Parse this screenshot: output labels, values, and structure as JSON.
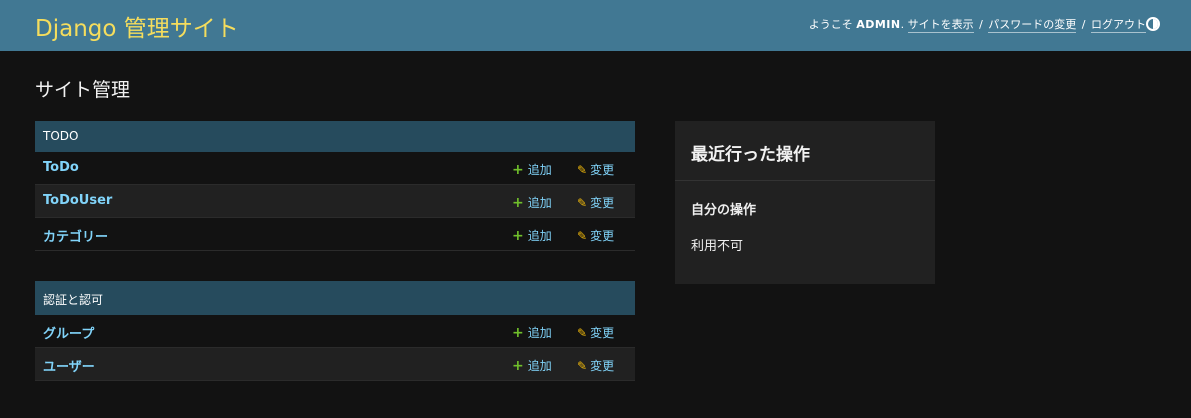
{
  "header": {
    "branding": "Django 管理サイト",
    "welcome": "ようこそ ",
    "username": "ADMIN",
    "welcome_suffix": ". ",
    "view_site": "サイトを表示",
    "separator": " / ",
    "change_password": "パスワードの変更",
    "logout": "ログアウト",
    "theme_icon": "half-circle-icon"
  },
  "page": {
    "title": "サイト管理"
  },
  "apps": [
    {
      "caption": "TODO",
      "models": [
        {
          "name": "ToDo",
          "add": "追加",
          "change": "変更"
        },
        {
          "name": "ToDoUser",
          "add": "追加",
          "change": "変更"
        },
        {
          "name": "カテゴリー",
          "add": "追加",
          "change": "変更"
        }
      ]
    },
    {
      "caption": "認証と認可",
      "models": [
        {
          "name": "グループ",
          "add": "追加",
          "change": "変更"
        },
        {
          "name": "ユーザー",
          "add": "追加",
          "change": "変更"
        }
      ]
    }
  ],
  "recent_actions": {
    "title": "最近行った操作",
    "my_actions": "自分の操作",
    "none_available": "利用不可"
  },
  "colors": {
    "header_bg": "#417893",
    "branding": "#f5dd5d",
    "module_caption_bg": "#264b5d",
    "link": "#81d4fa",
    "add_icon": "#70bf2b",
    "change_icon": "#efb80b",
    "body_bg": "#121212"
  }
}
